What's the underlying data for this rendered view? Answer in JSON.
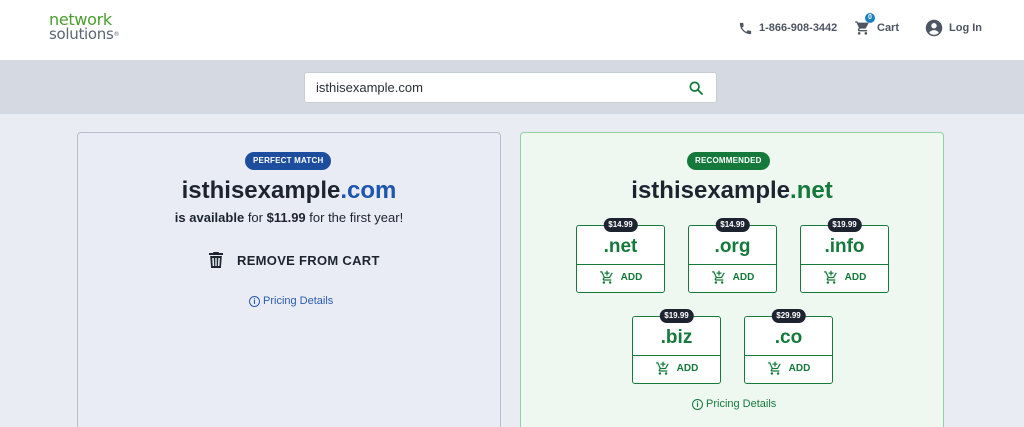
{
  "header": {
    "logo_line1": "network",
    "logo_line2": "solutions",
    "logo_mark": "®",
    "phone": "1-866-908-3442",
    "cart_label": "Cart",
    "cart_count": "0",
    "login_label": "Log In"
  },
  "search": {
    "value": "isthisexample.com"
  },
  "match_card": {
    "badge": "PERFECT MATCH",
    "domain_name": "isthisexample",
    "domain_tld": ".com",
    "availability_bold": "is available",
    "availability_mid": "for",
    "price": "$11.99",
    "availability_tail": "for the first year!",
    "remove_label": "REMOVE FROM CART",
    "pricing_details": "Pricing Details"
  },
  "recommended_card": {
    "badge": "RECOMMENDED",
    "domain_name": "isthisexample",
    "domain_tld": ".net",
    "pricing_details": "Pricing Details",
    "add_label": "ADD",
    "tlds": [
      {
        "name": ".net",
        "price": "$14.99"
      },
      {
        "name": ".org",
        "price": "$14.99"
      },
      {
        "name": ".info",
        "price": "$19.99"
      },
      {
        "name": ".biz",
        "price": "$19.99"
      },
      {
        "name": ".co",
        "price": "$29.99"
      }
    ]
  },
  "colors": {
    "brand_green": "#16793c",
    "brand_blue": "#1d4e9e",
    "price_pill": "#1d2430"
  },
  "icons": [
    "phone-icon",
    "cart-icon",
    "user-icon",
    "search-icon",
    "trash-icon",
    "info-icon",
    "cart-add-icon"
  ]
}
